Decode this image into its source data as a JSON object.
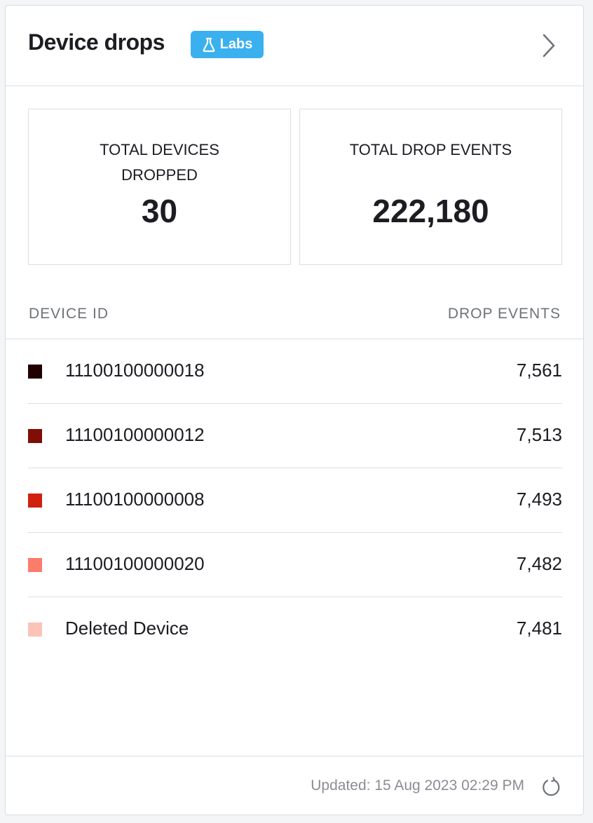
{
  "widget": {
    "title": "Device drops",
    "badge_label": "Labs",
    "badge_icon": "flask-icon",
    "badge_color": "#3ab0ef",
    "expand_icon": "chevron-right-icon"
  },
  "stats": {
    "total_devices_label": "TOTAL DEVICES DROPPED",
    "total_devices_value": "30",
    "total_events_label": "TOTAL DROP EVENTS",
    "total_events_value": "222,180"
  },
  "table": {
    "col_device": "DEVICE ID",
    "col_events": "DROP EVENTS",
    "rows": [
      {
        "device": "11100100000018",
        "events": "7,561",
        "color": "#200000"
      },
      {
        "device": "11100100000012",
        "events": "7,513",
        "color": "#7e0e06"
      },
      {
        "device": "11100100000008",
        "events": "7,493",
        "color": "#d0200e"
      },
      {
        "device": "11100100000020",
        "events": "7,482",
        "color": "#fa7c6a"
      },
      {
        "device": "Deleted Device",
        "events": "7,481",
        "color": "#fcc3b9"
      }
    ]
  },
  "footer": {
    "updated_text": "Updated: 15 Aug 2023 02:29 PM",
    "refresh_icon": "refresh-icon"
  }
}
